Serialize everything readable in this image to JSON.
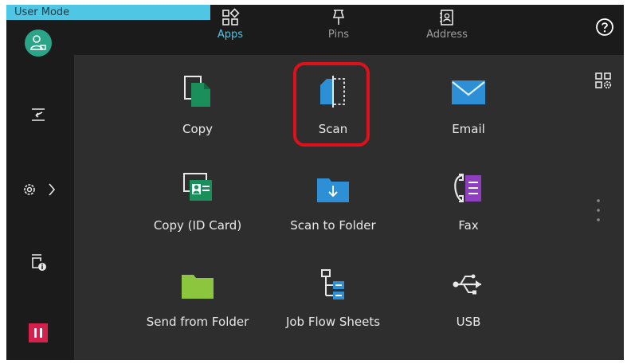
{
  "header": {
    "user_mode_label": "User Mode"
  },
  "nav": {
    "tabs": [
      {
        "label": "Apps",
        "icon": "apps-grid-icon",
        "active": true
      },
      {
        "label": "Pins",
        "icon": "pin-icon",
        "active": false
      },
      {
        "label": "Address",
        "icon": "address-book-icon",
        "active": false
      }
    ],
    "help_icon": "help-icon"
  },
  "sidebar": {
    "items": [
      {
        "icon": "user-login-icon"
      },
      {
        "icon": "job-status-icon"
      },
      {
        "icon": "device-settings-icon"
      },
      {
        "icon": "machine-info-icon"
      },
      {
        "icon": "pause-icon"
      }
    ]
  },
  "apps": [
    {
      "label": "Copy",
      "icon": "copy-icon"
    },
    {
      "label": "Scan",
      "icon": "scan-icon"
    },
    {
      "label": "Email",
      "icon": "email-icon"
    },
    {
      "label": "Copy (ID Card)",
      "icon": "id-card-copy-icon"
    },
    {
      "label": "Scan to Folder",
      "icon": "scan-to-folder-icon"
    },
    {
      "label": "Fax",
      "icon": "fax-icon"
    },
    {
      "label": "Send from Folder",
      "icon": "send-from-folder-icon"
    },
    {
      "label": "Job Flow Sheets",
      "icon": "job-flow-sheets-icon"
    },
    {
      "label": "USB",
      "icon": "usb-icon"
    }
  ],
  "colors": {
    "accent": "#4fc6e4",
    "highlight": "#e0101a",
    "copy_green": "#1a8f5c",
    "scan_blue": "#2d8fd5",
    "fax_purple": "#8e3fbf",
    "folder_green": "#8cc63e",
    "pause_red": "#d6204c",
    "login_green": "#2aa587"
  }
}
